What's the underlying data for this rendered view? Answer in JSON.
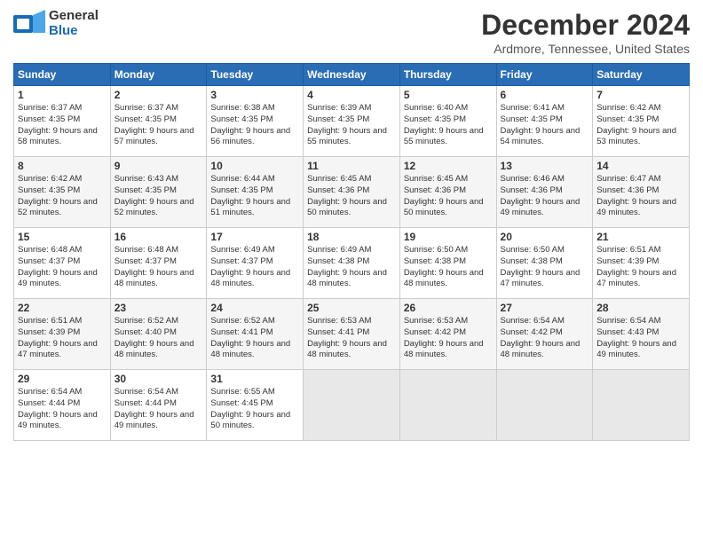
{
  "header": {
    "logo_line1": "General",
    "logo_line2": "Blue",
    "title": "December 2024",
    "location": "Ardmore, Tennessee, United States"
  },
  "days_of_week": [
    "Sunday",
    "Monday",
    "Tuesday",
    "Wednesday",
    "Thursday",
    "Friday",
    "Saturday"
  ],
  "weeks": [
    [
      {
        "day": 1,
        "sunrise": "6:37 AM",
        "sunset": "4:35 PM",
        "daylight": "9 hours and 58 minutes."
      },
      {
        "day": 2,
        "sunrise": "6:37 AM",
        "sunset": "4:35 PM",
        "daylight": "9 hours and 57 minutes."
      },
      {
        "day": 3,
        "sunrise": "6:38 AM",
        "sunset": "4:35 PM",
        "daylight": "9 hours and 56 minutes."
      },
      {
        "day": 4,
        "sunrise": "6:39 AM",
        "sunset": "4:35 PM",
        "daylight": "9 hours and 55 minutes."
      },
      {
        "day": 5,
        "sunrise": "6:40 AM",
        "sunset": "4:35 PM",
        "daylight": "9 hours and 55 minutes."
      },
      {
        "day": 6,
        "sunrise": "6:41 AM",
        "sunset": "4:35 PM",
        "daylight": "9 hours and 54 minutes."
      },
      {
        "day": 7,
        "sunrise": "6:42 AM",
        "sunset": "4:35 PM",
        "daylight": "9 hours and 53 minutes."
      }
    ],
    [
      {
        "day": 8,
        "sunrise": "6:42 AM",
        "sunset": "4:35 PM",
        "daylight": "9 hours and 52 minutes."
      },
      {
        "day": 9,
        "sunrise": "6:43 AM",
        "sunset": "4:35 PM",
        "daylight": "9 hours and 52 minutes."
      },
      {
        "day": 10,
        "sunrise": "6:44 AM",
        "sunset": "4:35 PM",
        "daylight": "9 hours and 51 minutes."
      },
      {
        "day": 11,
        "sunrise": "6:45 AM",
        "sunset": "4:36 PM",
        "daylight": "9 hours and 50 minutes."
      },
      {
        "day": 12,
        "sunrise": "6:45 AM",
        "sunset": "4:36 PM",
        "daylight": "9 hours and 50 minutes."
      },
      {
        "day": 13,
        "sunrise": "6:46 AM",
        "sunset": "4:36 PM",
        "daylight": "9 hours and 49 minutes."
      },
      {
        "day": 14,
        "sunrise": "6:47 AM",
        "sunset": "4:36 PM",
        "daylight": "9 hours and 49 minutes."
      }
    ],
    [
      {
        "day": 15,
        "sunrise": "6:48 AM",
        "sunset": "4:37 PM",
        "daylight": "9 hours and 49 minutes."
      },
      {
        "day": 16,
        "sunrise": "6:48 AM",
        "sunset": "4:37 PM",
        "daylight": "9 hours and 48 minutes."
      },
      {
        "day": 17,
        "sunrise": "6:49 AM",
        "sunset": "4:37 PM",
        "daylight": "9 hours and 48 minutes."
      },
      {
        "day": 18,
        "sunrise": "6:49 AM",
        "sunset": "4:38 PM",
        "daylight": "9 hours and 48 minutes."
      },
      {
        "day": 19,
        "sunrise": "6:50 AM",
        "sunset": "4:38 PM",
        "daylight": "9 hours and 48 minutes."
      },
      {
        "day": 20,
        "sunrise": "6:50 AM",
        "sunset": "4:38 PM",
        "daylight": "9 hours and 47 minutes."
      },
      {
        "day": 21,
        "sunrise": "6:51 AM",
        "sunset": "4:39 PM",
        "daylight": "9 hours and 47 minutes."
      }
    ],
    [
      {
        "day": 22,
        "sunrise": "6:51 AM",
        "sunset": "4:39 PM",
        "daylight": "9 hours and 47 minutes."
      },
      {
        "day": 23,
        "sunrise": "6:52 AM",
        "sunset": "4:40 PM",
        "daylight": "9 hours and 48 minutes."
      },
      {
        "day": 24,
        "sunrise": "6:52 AM",
        "sunset": "4:41 PM",
        "daylight": "9 hours and 48 minutes."
      },
      {
        "day": 25,
        "sunrise": "6:53 AM",
        "sunset": "4:41 PM",
        "daylight": "9 hours and 48 minutes."
      },
      {
        "day": 26,
        "sunrise": "6:53 AM",
        "sunset": "4:42 PM",
        "daylight": "9 hours and 48 minutes."
      },
      {
        "day": 27,
        "sunrise": "6:54 AM",
        "sunset": "4:42 PM",
        "daylight": "9 hours and 48 minutes."
      },
      {
        "day": 28,
        "sunrise": "6:54 AM",
        "sunset": "4:43 PM",
        "daylight": "9 hours and 49 minutes."
      }
    ],
    [
      {
        "day": 29,
        "sunrise": "6:54 AM",
        "sunset": "4:44 PM",
        "daylight": "9 hours and 49 minutes."
      },
      {
        "day": 30,
        "sunrise": "6:54 AM",
        "sunset": "4:44 PM",
        "daylight": "9 hours and 49 minutes."
      },
      {
        "day": 31,
        "sunrise": "6:55 AM",
        "sunset": "4:45 PM",
        "daylight": "9 hours and 50 minutes."
      },
      null,
      null,
      null,
      null
    ]
  ]
}
